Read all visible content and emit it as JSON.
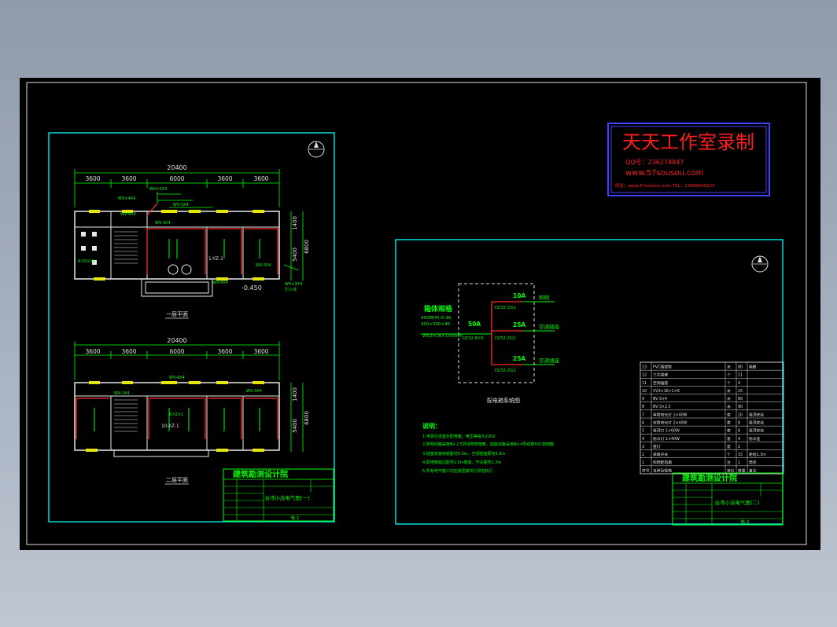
{
  "colors": {
    "background": "#000000",
    "frame": "#e0e0e0",
    "sheet_border": "#00ffff",
    "lines": "#00ff00",
    "walls": "#e8e8e8",
    "circuit": "#ff2a2a",
    "fixtures": "#e6e600",
    "watermark_text": "#ff1e1e",
    "watermark_border": "#4040ff",
    "app_background": "#a4aebd"
  },
  "plans": {
    "dimensions": {
      "total": "20400",
      "bays": [
        "3600",
        "3600",
        "6000",
        "3600",
        "3600"
      ],
      "depth_a": "1400",
      "depth_b": "5400",
      "depth_total": "6800"
    },
    "first_floor": {
      "caption": "一层平面",
      "elevation": "-0.450",
      "labels": [
        "WV×3X4",
        "WV×4X4",
        "WV-3X4",
        "WV-4X4",
        "WV-3X4",
        "4-YZ×25",
        "1-YZ-1",
        "WV-4X4",
        "WV-3X4",
        "引入线",
        "WV×3X4"
      ]
    },
    "second_floor": {
      "caption": "二层平面",
      "labels": [
        "WV-3X4",
        "WV-4X4",
        "WV-3X4",
        "6-YZ×1",
        "10-YZ-1"
      ]
    }
  },
  "title_blocks": {
    "institute": "建筑勘测设计院",
    "left": {
      "drawing_title": "台湾小店电气图(一)",
      "sheet": "电-1"
    },
    "right": {
      "drawing_title": "台湾小店电气图(二)",
      "sheet": "电-2"
    }
  },
  "schematic": {
    "caption": "配电箱系统图",
    "panel_label": "箱体规格",
    "panel_specs": [
      "450M(H)-0-3A",
      "300×300×40",
      "WV3×16+1×6mm"
    ],
    "main_breaker": {
      "rating": "50A",
      "model": "DZ32-50/3"
    },
    "branches": [
      {
        "rating": "10A",
        "model": "DZ32-10/1",
        "load": "照明"
      },
      {
        "rating": "25A",
        "model": "DZ32-25/1",
        "load": "空调插座"
      },
      {
        "rating": "25A",
        "model": "DZ32-25/1",
        "load": "空调插座"
      }
    ]
  },
  "notes": {
    "heading": "说明：",
    "lines": [
      "1.电源引自室外配电箱，电压等级为220V",
      "2.照明线路采用BV-2.5导线穿管暗敷，插座线路采用BV-4导线穿PVC管暗敷",
      "3.插座安装高度距地0.3m，空调插座距地1.8m",
      "4.配电箱底边距地1.5m暗装，开关距地1.3m",
      "5.所有电气施工均应按国家现行规范执行"
    ]
  },
  "legend": {
    "rows": [
      {
        "no": "13",
        "name": "PVC阻燃管",
        "unit": "米",
        "qty": "80",
        "note": "暗敷"
      },
      {
        "no": "12",
        "name": "三芯插座",
        "unit": "个",
        "qty": "11",
        "note": ""
      },
      {
        "no": "11",
        "name": "空调插座",
        "unit": "个",
        "qty": "4",
        "note": ""
      },
      {
        "no": "10",
        "name": "VV3×16+1×6",
        "unit": "米",
        "qty": "25",
        "note": ""
      },
      {
        "no": "9",
        "name": "BV-3×4",
        "unit": "米",
        "qty": "60",
        "note": ""
      },
      {
        "no": "8",
        "name": "BV-3×2.5",
        "unit": "米",
        "qty": "90",
        "note": ""
      },
      {
        "no": "7",
        "name": "单管荧光灯 1×40W",
        "unit": "套",
        "qty": "10",
        "note": "吸顶安装"
      },
      {
        "no": "6",
        "name": "双管荧光灯 2×40W",
        "unit": "套",
        "qty": "8",
        "note": "吸顶安装"
      },
      {
        "no": "5",
        "name": "吸顶灯 1×60W",
        "unit": "套",
        "qty": "6",
        "note": "吸顶安装"
      },
      {
        "no": "4",
        "name": "防水灯 1×40W",
        "unit": "套",
        "qty": "4",
        "note": "防水型"
      },
      {
        "no": "3",
        "name": "壁灯",
        "unit": "套",
        "qty": "2",
        "note": ""
      },
      {
        "no": "2",
        "name": "单联开关",
        "unit": "个",
        "qty": "15",
        "note": "距地1.3m"
      },
      {
        "no": "1",
        "name": "照明配电箱",
        "unit": "台",
        "qty": "1",
        "note": "暗装"
      }
    ],
    "header": {
      "no": "序号",
      "name": "名称及规格",
      "unit": "单位",
      "qty": "数量",
      "note": "备注"
    }
  },
  "watermark": {
    "title": "天天工作室录制",
    "qq": "QQ号：236274847",
    "site": "www.57sousou.com",
    "footer": "网址：www.57sousou.com  TEL：13689900229"
  }
}
